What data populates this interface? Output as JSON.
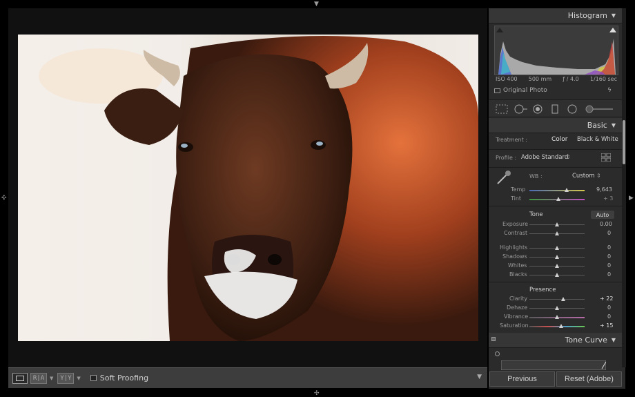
{
  "histogram": {
    "title": "Histogram",
    "iso": "ISO 400",
    "focal": "500 mm",
    "aperture": "ƒ / 4.0",
    "shutter": "1/160 sec",
    "original_photo_label": "Original Photo"
  },
  "basic": {
    "title": "Basic",
    "treatment_label": "Treatment :",
    "treatment_color": "Color",
    "treatment_bw": "Black & White",
    "profile_label": "Profile :",
    "profile_value": "Adobe Standard",
    "wb_label": "WB :",
    "wb_value": "Custom",
    "temp": {
      "label": "Temp",
      "value": "9,643",
      "position": 0.68
    },
    "tint": {
      "label": "Tint",
      "value": "+ 3",
      "position": 0.52
    },
    "tone_label": "Tone",
    "auto_label": "Auto",
    "exposure": {
      "label": "Exposure",
      "value": "0.00",
      "position": 0.5
    },
    "contrast": {
      "label": "Contrast",
      "value": "0",
      "position": 0.5
    },
    "highlights": {
      "label": "Highlights",
      "value": "0",
      "position": 0.5
    },
    "shadows": {
      "label": "Shadows",
      "value": "0",
      "position": 0.5
    },
    "whites": {
      "label": "Whites",
      "value": "0",
      "position": 0.5
    },
    "blacks": {
      "label": "Blacks",
      "value": "0",
      "position": 0.5
    },
    "presence_label": "Presence",
    "clarity": {
      "label": "Clarity",
      "value": "+ 22",
      "position": 0.61
    },
    "dehaze": {
      "label": "Dehaze",
      "value": "0",
      "position": 0.5
    },
    "vibrance": {
      "label": "Vibrance",
      "value": "0",
      "position": 0.5
    },
    "saturation": {
      "label": "Saturation",
      "value": "+ 15",
      "position": 0.575
    }
  },
  "tone_curve": {
    "title": "Tone Curve"
  },
  "toolbar": {
    "soft_proofing": "Soft Proofing",
    "ra_label": "R|A",
    "yy_label": "Y|Y"
  },
  "buttons": {
    "previous": "Previous",
    "reset": "Reset (Adobe)"
  }
}
